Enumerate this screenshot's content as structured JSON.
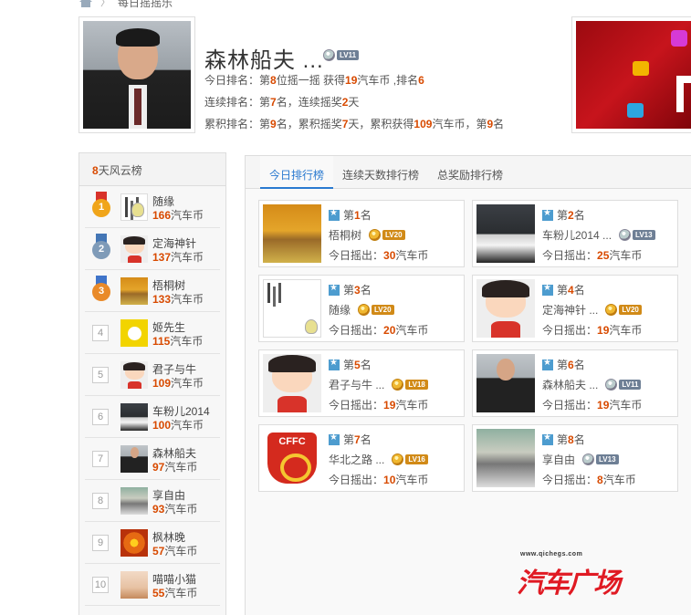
{
  "breadcrumb": {
    "current": "每日摇摇乐"
  },
  "profile": {
    "name": "森林船夫 ...",
    "level": "LV11",
    "today_line": [
      {
        "t": "今日排名：第",
        "h": false
      },
      {
        "t": "8",
        "h": true
      },
      {
        "t": "位摇一摇 获得",
        "h": false
      },
      {
        "t": "19",
        "h": true
      },
      {
        "t": "汽车币 ,排名",
        "h": false
      },
      {
        "t": "6",
        "h": true
      }
    ],
    "streak_line": [
      {
        "t": "连续排名：第",
        "h": false
      },
      {
        "t": "7",
        "h": true
      },
      {
        "t": "名，连续摇奖",
        "h": false
      },
      {
        "t": "2",
        "h": true
      },
      {
        "t": "天",
        "h": false
      }
    ],
    "total_line": [
      {
        "t": "累积排名：第",
        "h": false
      },
      {
        "t": "9",
        "h": true
      },
      {
        "t": "名，累积摇奖",
        "h": false
      },
      {
        "t": "7",
        "h": true
      },
      {
        "t": "天，累积获得",
        "h": false
      },
      {
        "t": "109",
        "h": true
      },
      {
        "t": "汽车币，第",
        "h": false
      },
      {
        "t": "9",
        "h": true
      },
      {
        "t": "名",
        "h": false
      }
    ]
  },
  "sidebar": {
    "title_num": "8",
    "title_text": "天风云榜",
    "unit": "汽车币",
    "items": [
      {
        "rank": "1",
        "name": "随缘",
        "coins": "166",
        "thumb": "t-calli",
        "medal": "gold"
      },
      {
        "rank": "2",
        "name": "定海神针",
        "coins": "137",
        "thumb": "t-cartoon",
        "medal": "silver"
      },
      {
        "rank": "3",
        "name": "梧桐树",
        "coins": "133",
        "thumb": "t-tree",
        "medal": "bronze"
      },
      {
        "rank": "4",
        "name": "姬先生",
        "coins": "115",
        "thumb": "t-duck",
        "medal": ""
      },
      {
        "rank": "5",
        "name": "君子与牛",
        "coins": "109",
        "thumb": "t-cartoon",
        "medal": ""
      },
      {
        "rank": "6",
        "name": "车粉儿2014",
        "coins": "100",
        "thumb": "t-car",
        "medal": ""
      },
      {
        "rank": "7",
        "name": "森林船夫",
        "coins": "97",
        "thumb": "t-man",
        "medal": ""
      },
      {
        "rank": "8",
        "name": "享自由",
        "coins": "93",
        "thumb": "t-street",
        "medal": ""
      },
      {
        "rank": "9",
        "name": "枫林晚",
        "coins": "57",
        "thumb": "t-leaf",
        "medal": ""
      },
      {
        "rank": "10",
        "name": "喵喵小猫",
        "coins": "55",
        "thumb": "t-girl",
        "medal": ""
      }
    ]
  },
  "tabs": [
    {
      "label": "今日排行榜",
      "active": true
    },
    {
      "label": "连续天数排行榜",
      "active": false
    },
    {
      "label": "总奖励排行榜",
      "active": false
    }
  ],
  "cards_text": {
    "rank_prefix": "第",
    "rank_suffix": "名",
    "shake_prefix": "今日摇出：",
    "unit": "汽车币"
  },
  "cards": [
    {
      "rank": "1",
      "name": "梧桐树",
      "level": "LV20",
      "gold": true,
      "coins": "30",
      "thumb": "t-tree"
    },
    {
      "rank": "2",
      "name": "车粉儿2014 ...",
      "level": "LV13",
      "gold": false,
      "coins": "25",
      "thumb": "t-car"
    },
    {
      "rank": "3",
      "name": "随缘",
      "level": "LV20",
      "gold": true,
      "coins": "20",
      "thumb": "t-calli"
    },
    {
      "rank": "4",
      "name": "定海神针 ...",
      "level": "LV20",
      "gold": true,
      "coins": "19",
      "thumb": "t-cartoon"
    },
    {
      "rank": "5",
      "name": "君子与牛 ...",
      "level": "LV18",
      "gold": true,
      "coins": "19",
      "thumb": "t-cartoon"
    },
    {
      "rank": "6",
      "name": "森林船夫 ...",
      "level": "LV11",
      "gold": false,
      "coins": "19",
      "thumb": "t-man"
    },
    {
      "rank": "7",
      "name": "华北之路 ...",
      "level": "LV16",
      "gold": true,
      "coins": "10",
      "thumb": "t-fc"
    },
    {
      "rank": "8",
      "name": "享自由",
      "level": "LV13",
      "gold": false,
      "coins": "8",
      "thumb": "t-street"
    }
  ],
  "logo": {
    "url": "www.qichegs.com",
    "text": "汽车广场"
  },
  "colors": {
    "accent": "#d84a00",
    "tab_active": "#2a7ad0",
    "medal_gold": "#f0a51a",
    "medal_silver": "#7f9bb8",
    "medal_bronze": "#e98a29"
  }
}
